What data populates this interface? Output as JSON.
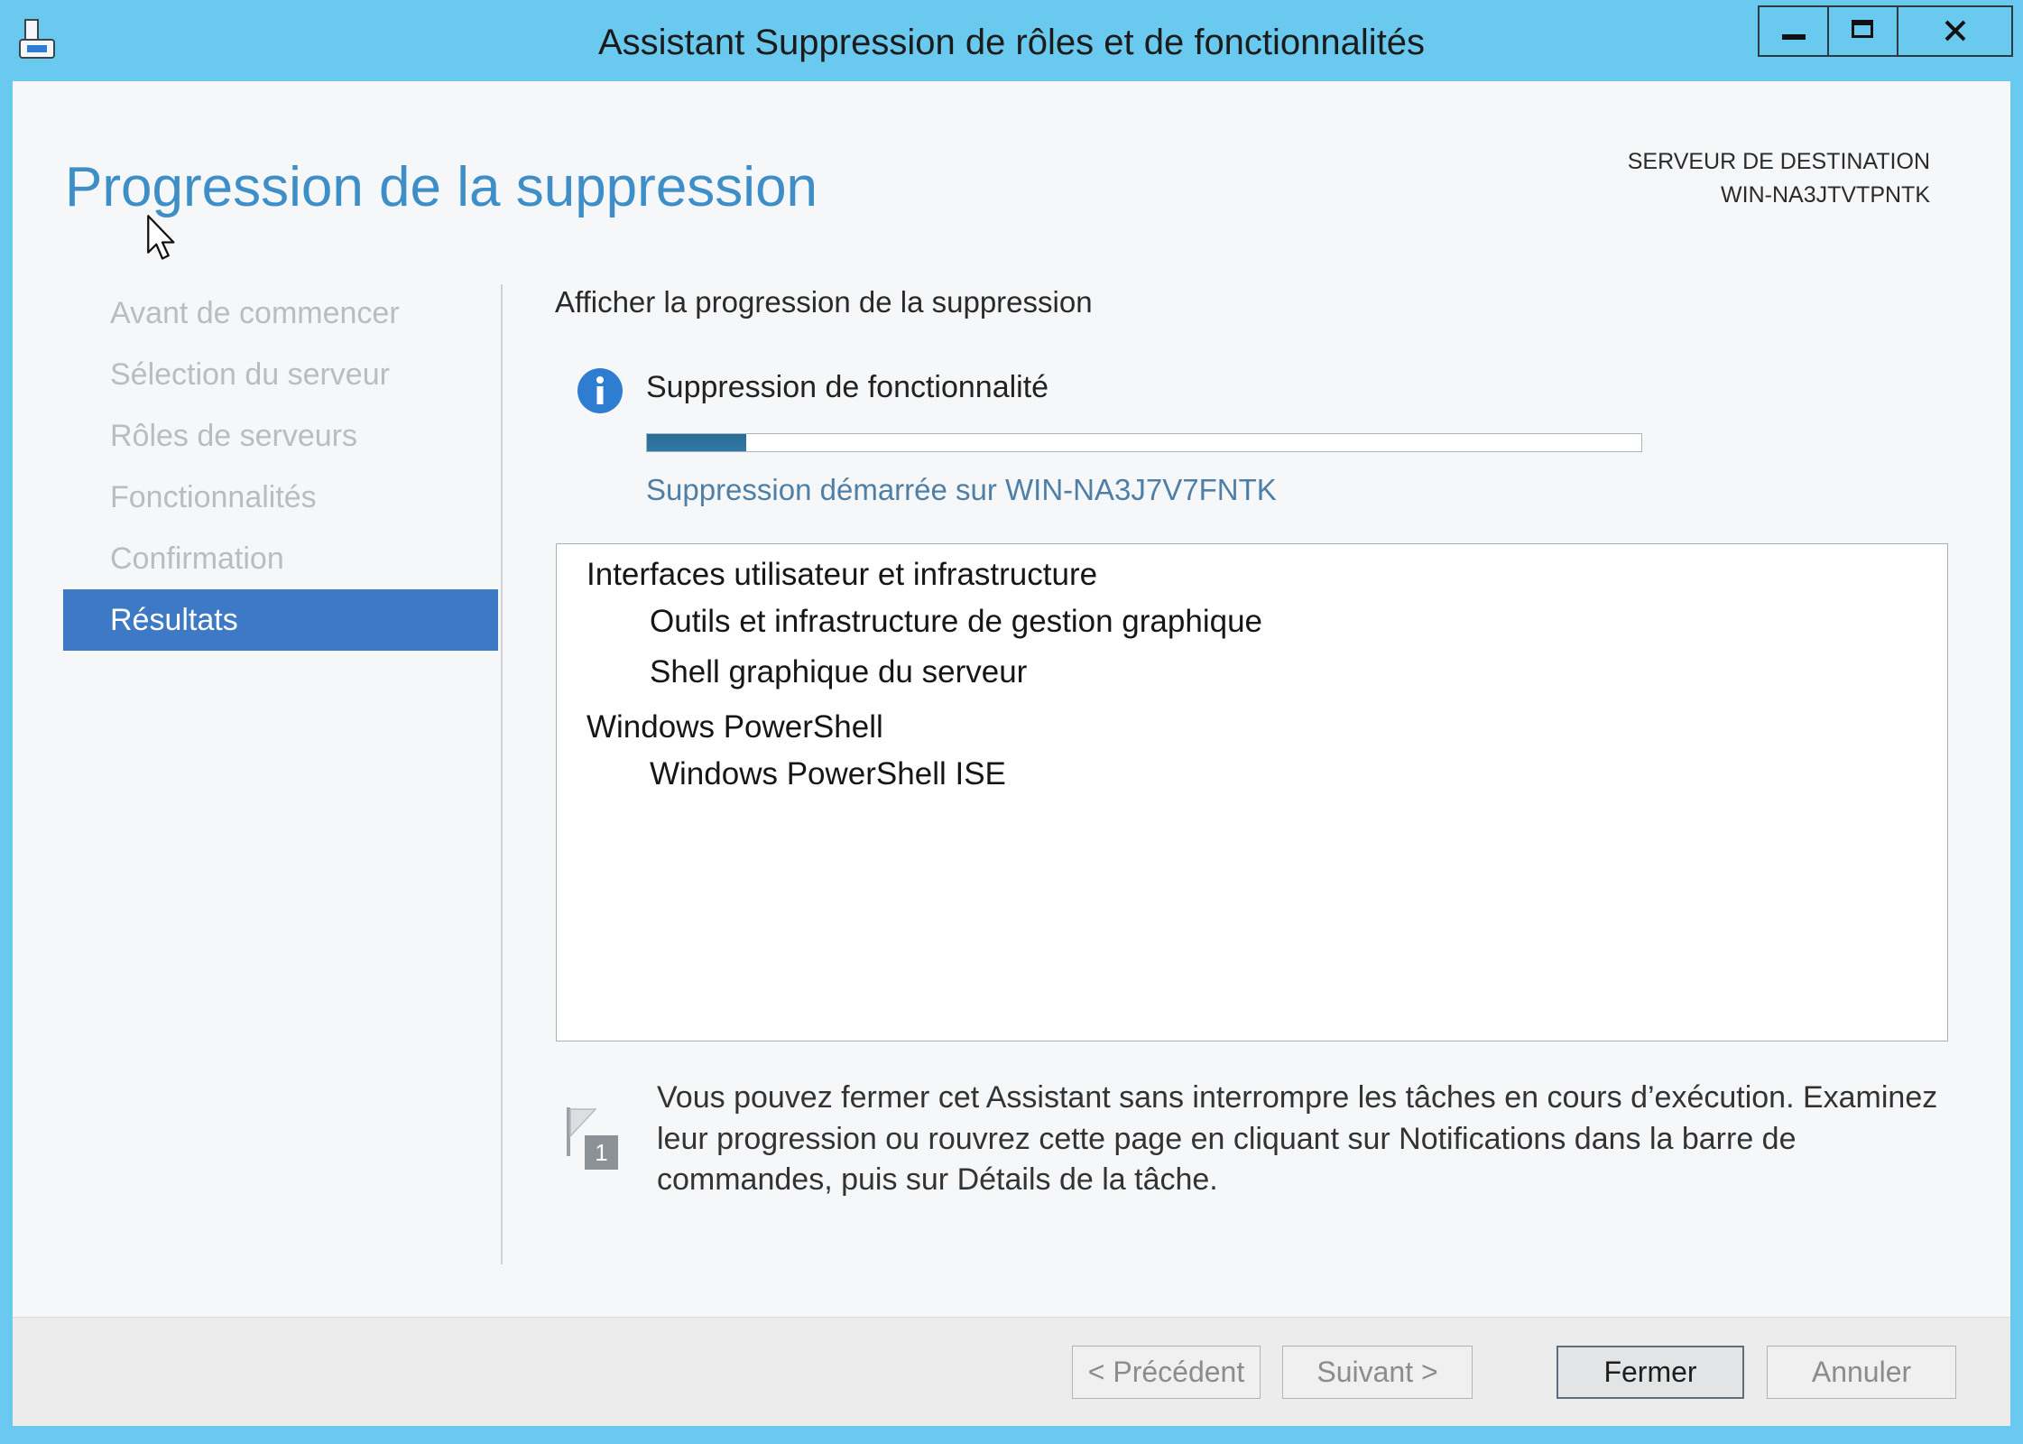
{
  "window": {
    "title": "Assistant Suppression de rôles et de fonctionnalités",
    "app_icon": "server-manager-icon",
    "controls": [
      "minimize-icon",
      "maximize-icon",
      "close-icon"
    ]
  },
  "header": {
    "page_title": "Progression de la suppression",
    "destination_label": "SERVEUR DE DESTINATION",
    "destination_server": "WIN-NA3JTVTPNTK"
  },
  "nav": {
    "items": [
      {
        "label": "Avant de commencer",
        "selected": false
      },
      {
        "label": "Sélection du serveur",
        "selected": false
      },
      {
        "label": "Rôles de serveurs",
        "selected": false
      },
      {
        "label": "Fonctionnalités",
        "selected": false
      },
      {
        "label": "Confirmation",
        "selected": false
      },
      {
        "label": "Résultats",
        "selected": true
      }
    ]
  },
  "main": {
    "heading": "Afficher la progression de la suppression",
    "task": {
      "icon": "info-icon",
      "title": "Suppression de fonctionnalité",
      "progress": 0.1,
      "message": "Suppression démarrée sur WIN-NA3J7V7FNTK"
    },
    "features": [
      {
        "label": "Interfaces utilisateur et infrastructure",
        "children": [
          "Outils et infrastructure de gestion graphique",
          "Shell graphique du serveur"
        ]
      },
      {
        "label": "Windows PowerShell",
        "children": [
          "Windows PowerShell ISE"
        ]
      }
    ],
    "notice": {
      "icon": "notification-flag-icon",
      "badge": "1",
      "lines": [
        "Vous pouvez fermer cet Assistant sans interrompre les tâches en cours d’exécution. Examinez",
        "leur progression ou rouvrez cette page en cliquant sur Notifications dans la barre de",
        "commandes, puis sur Détails de la tâche."
      ]
    }
  },
  "footer": {
    "buttons": [
      {
        "label": "< Précédent",
        "enabled": false
      },
      {
        "label": "Suivant >",
        "enabled": false
      },
      {
        "label": "Fermer",
        "enabled": true
      },
      {
        "label": "Annuler",
        "enabled": false
      }
    ]
  },
  "colors": {
    "frame": "#6ac9ee",
    "accent": "#3d79c4",
    "page_title": "#3e8ec8",
    "info": "#2f7dd1",
    "progress": "#2f7aa6",
    "status_text": "#4f7fa6"
  }
}
